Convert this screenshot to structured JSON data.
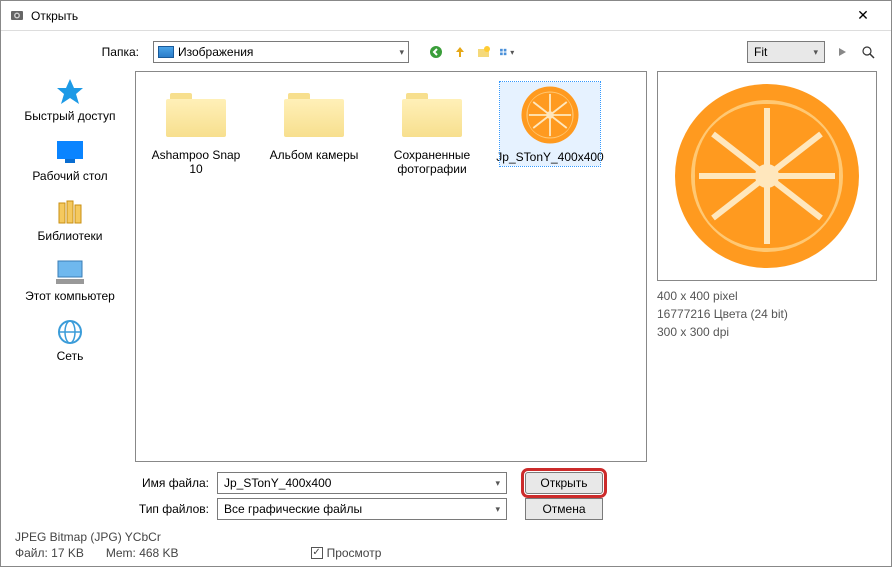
{
  "titlebar": {
    "title": "Открыть"
  },
  "folder": {
    "label": "Папка:",
    "value": "Изображения"
  },
  "fit": {
    "value": "Fit"
  },
  "sidebar": {
    "items": [
      {
        "label": "Быстрый доступ"
      },
      {
        "label": "Рабочий стол"
      },
      {
        "label": "Библиотеки"
      },
      {
        "label": "Этот компьютер"
      },
      {
        "label": "Сеть"
      }
    ]
  },
  "files": {
    "items": [
      {
        "label": "Ashampoo Snap 10"
      },
      {
        "label": "Альбом камеры"
      },
      {
        "label": "Сохраненные фотографии"
      },
      {
        "label": "Jp_STonY_400x400"
      }
    ]
  },
  "preview": {
    "dimensions": "400 x 400 pixel",
    "colors": "16777216 Цвета (24 bit)",
    "dpi": "300 x 300 dpi"
  },
  "filename": {
    "label": "Имя файла:",
    "value": "Jp_STonY_400x400"
  },
  "filetype": {
    "label": "Тип файлов:",
    "value": "Все графические файлы"
  },
  "buttons": {
    "open": "Открыть",
    "cancel": "Отмена"
  },
  "status": {
    "format": "JPEG Bitmap (JPG) YCbCr",
    "file": "Файл: 17 KB",
    "mem": "Mem: 468 KB",
    "preview_label": "Просмотр"
  }
}
